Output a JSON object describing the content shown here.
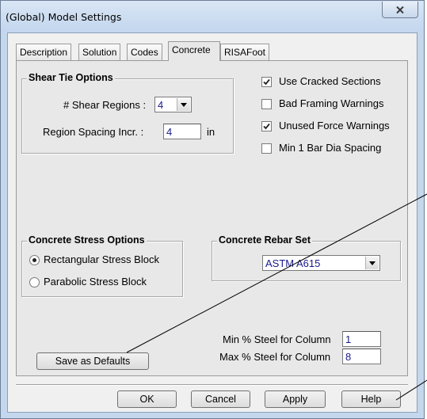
{
  "window": {
    "title": "(Global) Model Settings"
  },
  "tabs": [
    {
      "label": "Description"
    },
    {
      "label": "Solution"
    },
    {
      "label": "Codes"
    },
    {
      "label": "Concrete"
    },
    {
      "label": "RISAFoot"
    }
  ],
  "active_tab": "Concrete",
  "shear_tie": {
    "title": "Shear Tie Options",
    "regions_label": "# Shear Regions :",
    "regions_value": "4",
    "spacing_label": "Region Spacing Incr. :",
    "spacing_value": "4",
    "spacing_unit": "in"
  },
  "options": [
    {
      "label": "Use Cracked Sections",
      "checked": true
    },
    {
      "label": "Bad Framing Warnings",
      "checked": false
    },
    {
      "label": "Unused Force Warnings",
      "checked": true
    },
    {
      "label": "Min 1 Bar Dia Spacing",
      "checked": false
    }
  ],
  "stress": {
    "title": "Concrete Stress Options",
    "rectangular_label": "Rectangular Stress Block",
    "parabolic_label": "Parabolic Stress Block",
    "selected": "Rectangular Stress Block"
  },
  "rebar": {
    "title": "Concrete Rebar Set",
    "value": "ASTM A615"
  },
  "steel": {
    "min_label": "Min % Steel for Column",
    "min_value": "1",
    "max_label": "Max % Steel for Column",
    "max_value": "8"
  },
  "buttons": {
    "save_defaults": "Save as Defaults",
    "ok": "OK",
    "cancel": "Cancel",
    "apply": "Apply",
    "help": "Help"
  },
  "colors": {
    "frame": "#c4d7ec",
    "panel": "#e8e8e8",
    "value_text": "#1a1a8a"
  }
}
